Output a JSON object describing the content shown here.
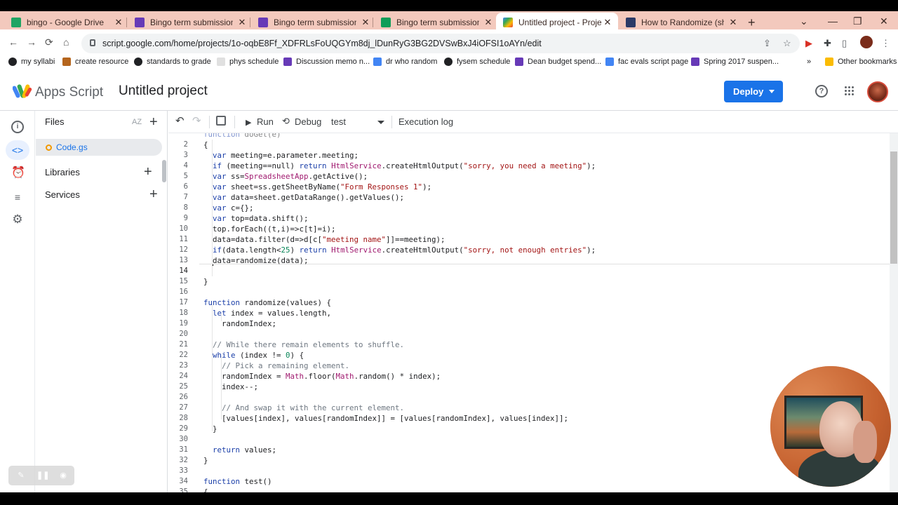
{
  "browser": {
    "tabs": [
      {
        "label": "bingo - Google Drive",
        "favicon_color": "#1fa463"
      },
      {
        "label": "Bingo term submissions - G",
        "favicon_color": "#673ab7"
      },
      {
        "label": "Bingo term submissions",
        "favicon_color": "#673ab7"
      },
      {
        "label": "Bingo term submissions (Re",
        "favicon_color": "#0f9d58"
      },
      {
        "label": "Untitled project - Project E",
        "favicon_color": "#4285f4"
      },
      {
        "label": "How to Randomize (shuffle",
        "favicon_color": "#2b3a67"
      }
    ],
    "active_tab_index": 4,
    "url": "script.google.com/home/projects/1o-oqbE8Ff_XDFRLsFoUQGYm8dj_lDunRyG3BG2DVSwBxJ4iOFSI1oAYn/edit",
    "bookmarks": [
      {
        "label": "my syllabi"
      },
      {
        "label": "create resource"
      },
      {
        "label": "standards to grade"
      },
      {
        "label": "phys schedule"
      },
      {
        "label": "Discussion memo n..."
      },
      {
        "label": "dr who random"
      },
      {
        "label": "fysem schedule"
      },
      {
        "label": "Dean budget spend..."
      },
      {
        "label": "fac evals script page"
      },
      {
        "label": "Spring 2017 suspen..."
      }
    ],
    "other_bookmarks": "Other bookmarks"
  },
  "app": {
    "name": "Apps Script",
    "project_title": "Untitled project",
    "deploy_label": "Deploy",
    "help_symbol": "?"
  },
  "files_panel": {
    "title": "Files",
    "sort_label": "AZ",
    "file": "Code.gs",
    "libraries": "Libraries",
    "services": "Services"
  },
  "toolbar": {
    "run": "Run",
    "debug": "Debug",
    "function_select": "test",
    "execution_log": "Execution log"
  },
  "editor": {
    "current_line": 14,
    "lines": [
      {
        "n": "",
        "text": "function doGet(e)"
      },
      {
        "n": "2",
        "text": "{"
      },
      {
        "n": "3",
        "text": "  var meeting=e.parameter.meeting;"
      },
      {
        "n": "4",
        "text": "  if (meeting==null) return HtmlService.createHtmlOutput(\"sorry, you need a meeting\");"
      },
      {
        "n": "5",
        "text": "  var ss=SpreadsheetApp.getActive();"
      },
      {
        "n": "6",
        "text": "  var sheet=ss.getSheetByName(\"Form Responses 1\");"
      },
      {
        "n": "7",
        "text": "  var data=sheet.getDataRange().getValues();"
      },
      {
        "n": "8",
        "text": "  var c={};"
      },
      {
        "n": "9",
        "text": "  var top=data.shift();"
      },
      {
        "n": "10",
        "text": "  top.forEach((t,i)=>c[t]=i);"
      },
      {
        "n": "11",
        "text": "  data=data.filter(d=>d[c[\"meeting name\"]]==meeting);"
      },
      {
        "n": "12",
        "text": "  if(data.length<25) return HtmlService.createHtmlOutput(\"sorry, not enough entries\");"
      },
      {
        "n": "13",
        "text": "  data=randomize(data);"
      },
      {
        "n": "14",
        "text": "  "
      },
      {
        "n": "15",
        "text": "}"
      },
      {
        "n": "16",
        "text": ""
      },
      {
        "n": "17",
        "text": "function randomize(values) {"
      },
      {
        "n": "18",
        "text": "  let index = values.length,"
      },
      {
        "n": "19",
        "text": "    randomIndex;"
      },
      {
        "n": "20",
        "text": ""
      },
      {
        "n": "21",
        "text": "  // While there remain elements to shuffle."
      },
      {
        "n": "22",
        "text": "  while (index != 0) {"
      },
      {
        "n": "23",
        "text": "    // Pick a remaining element."
      },
      {
        "n": "24",
        "text": "    randomIndex = Math.floor(Math.random() * index);"
      },
      {
        "n": "25",
        "text": "    index--;"
      },
      {
        "n": "26",
        "text": ""
      },
      {
        "n": "27",
        "text": "    // And swap it with the current element."
      },
      {
        "n": "28",
        "text": "    [values[index], values[randomIndex]] = [values[randomIndex], values[index]];"
      },
      {
        "n": "29",
        "text": "  }"
      },
      {
        "n": "30",
        "text": ""
      },
      {
        "n": "31",
        "text": "  return values;"
      },
      {
        "n": "32",
        "text": "}"
      },
      {
        "n": "33",
        "text": ""
      },
      {
        "n": "34",
        "text": "function test()"
      },
      {
        "n": "35",
        "text": "{"
      }
    ]
  },
  "colors": {
    "accent": "#1a73e8",
    "tabstrip": "#f3c9bd"
  }
}
